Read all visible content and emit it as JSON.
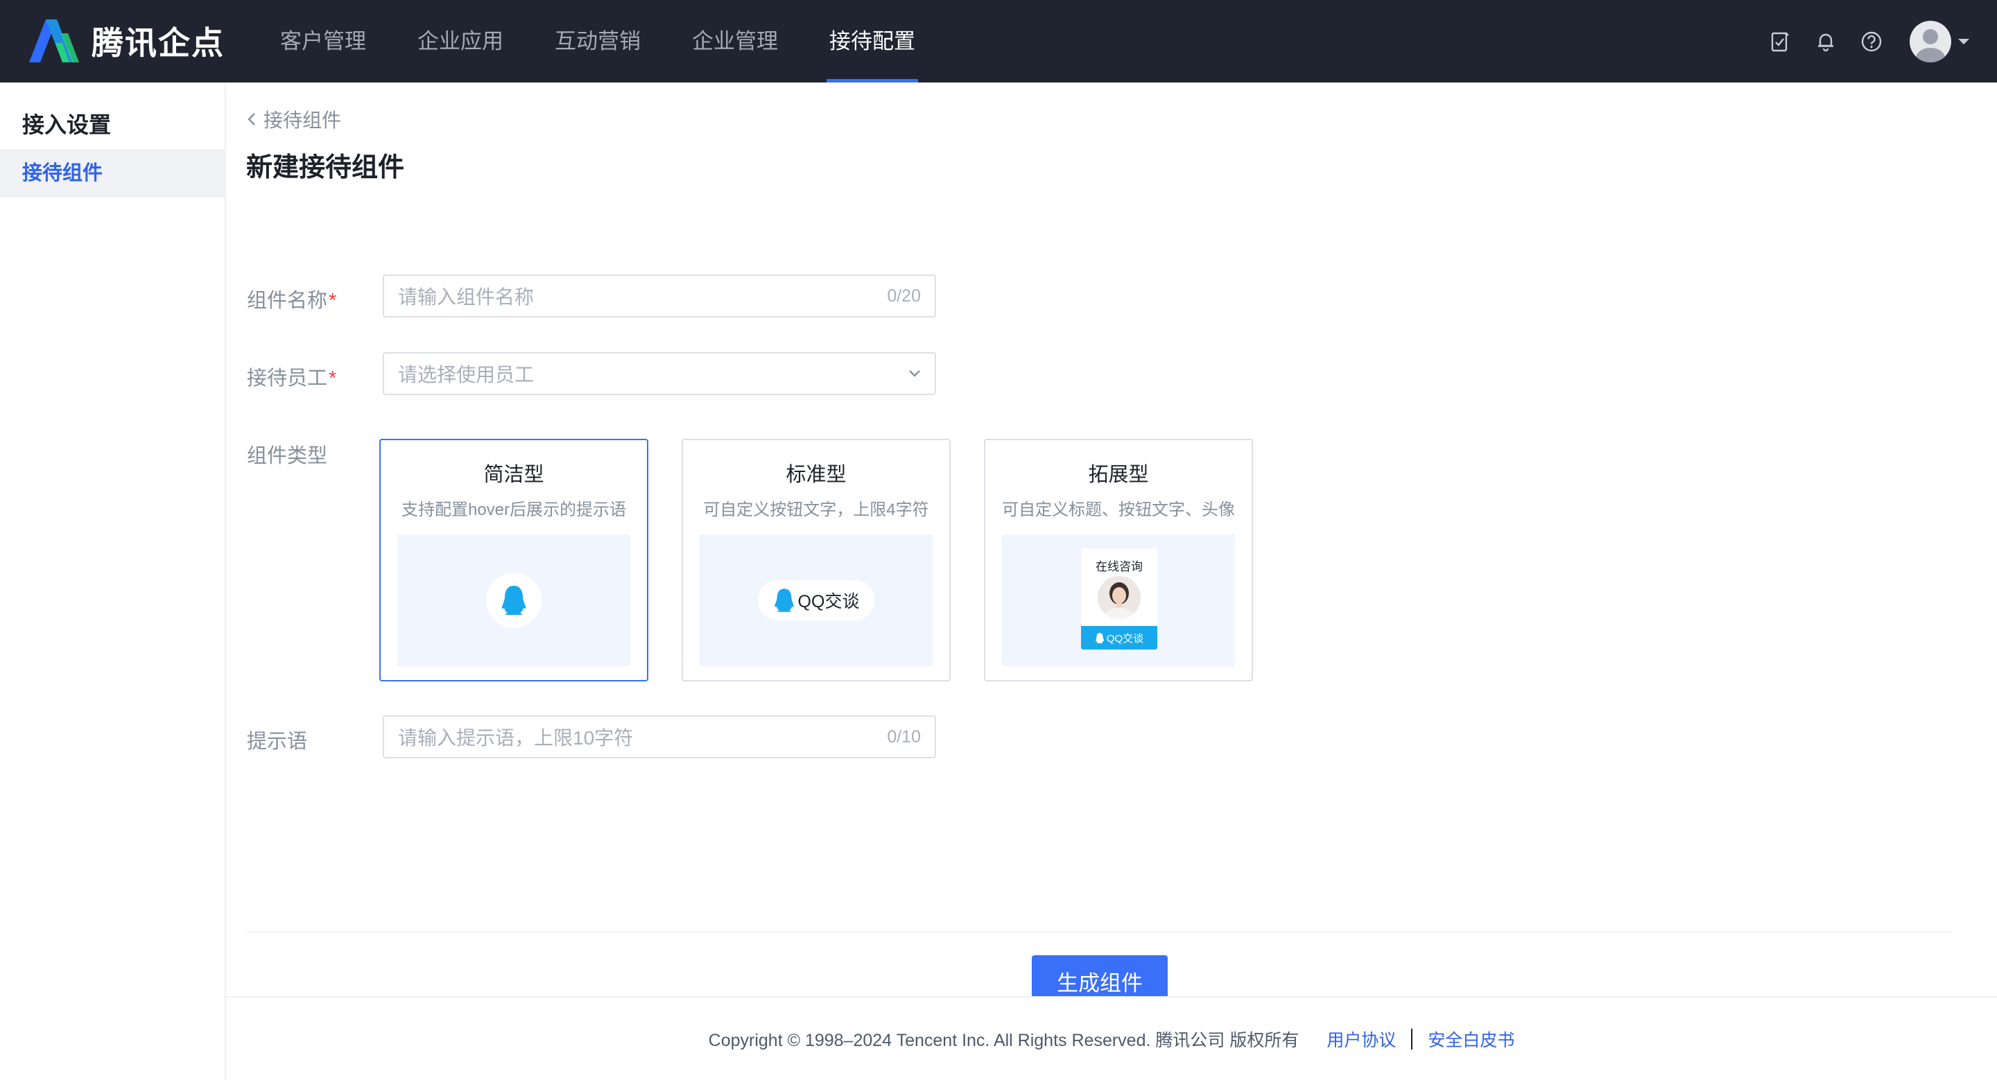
{
  "brand": {
    "name": "腾讯企点",
    "logo_colors": [
      "#2f6bff",
      "#26d07c"
    ]
  },
  "nav": {
    "items": [
      {
        "label": "客户管理"
      },
      {
        "label": "企业应用"
      },
      {
        "label": "互动营销"
      },
      {
        "label": "企业管理"
      },
      {
        "label": "接待配置"
      }
    ],
    "active_index": 4
  },
  "top_icons": [
    "task-check-icon",
    "bell-icon",
    "help-icon",
    "user-avatar"
  ],
  "sidebar": {
    "title": "接入设置",
    "items": [
      {
        "label": "接待组件",
        "active": true
      }
    ]
  },
  "breadcrumb": {
    "back_label": "接待组件"
  },
  "page": {
    "title": "新建接待组件"
  },
  "form": {
    "name": {
      "label": "组件名称",
      "required_mark": "*",
      "placeholder": "请输入组件名称",
      "count": "0/20"
    },
    "staff": {
      "label": "接待员工",
      "required_mark": "*",
      "placeholder": "请选择使用员工"
    },
    "type": {
      "label": "组件类型",
      "selected_index": 0,
      "cards": [
        {
          "title": "简洁型",
          "desc": "支持配置hover后展示的提示语"
        },
        {
          "title": "标准型",
          "desc": "可自定义按钮文字，上限4字符",
          "preview_label": "QQ交谈"
        },
        {
          "title": "拓展型",
          "desc": "可自定义标题、按钮文字、头像",
          "preview_title": "在线咨询",
          "preview_button": "QQ交谈"
        }
      ]
    },
    "tip": {
      "label": "提示语",
      "placeholder": "请输入提示语，上限10字符",
      "count": "0/10"
    }
  },
  "actions": {
    "submit_label": "生成组件"
  },
  "footer": {
    "copyright": "Copyright © 1998–2024 Tencent Inc. All Rights Reserved. 腾讯公司 版权所有",
    "link_agreement": "用户协议",
    "link_whitepaper": "安全白皮书"
  },
  "colors": {
    "topbar_bg": "#1f2430",
    "accent": "#3a6ff7",
    "link": "#2f63e8",
    "required": "#f53f3f",
    "qq_blue": "#1aa8ec"
  }
}
